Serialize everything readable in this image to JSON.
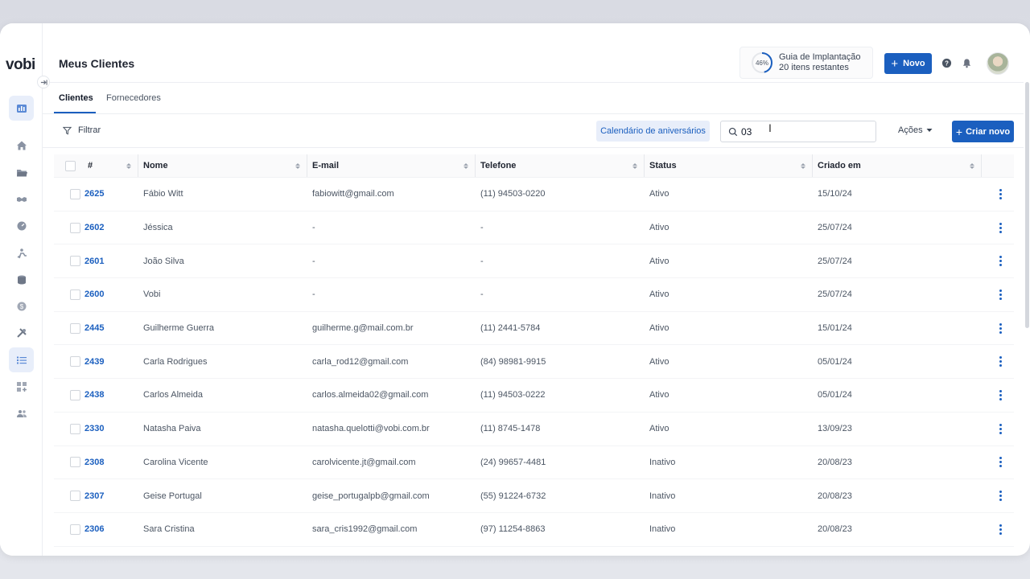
{
  "app": {
    "logo": "vobi"
  },
  "header": {
    "title": "Meus Clientes",
    "guide": {
      "percent": "46%",
      "progress": 0.46,
      "title": "Guia de Implantação",
      "subtitle": "20 itens restantes"
    },
    "new_button": "Novo"
  },
  "tabs": [
    {
      "label": "Clientes",
      "active": true
    },
    {
      "label": "Fornecedores",
      "active": false
    }
  ],
  "toolbar": {
    "filter_label": "Filtrar",
    "calendar_button": "Calendário de aniversários",
    "search_value": "03",
    "actions_label": "Ações",
    "create_button": "Criar novo"
  },
  "table": {
    "columns": [
      "#",
      "Nome",
      "E-mail",
      "Telefone",
      "Status",
      "Criado em"
    ],
    "rows": [
      {
        "id": "2625",
        "name": "Fábio Witt",
        "email": "fabiowitt@gmail.com",
        "phone": "(11) 94503-0220",
        "status": "Ativo",
        "created": "15/10/24"
      },
      {
        "id": "2602",
        "name": "Jéssica",
        "email": "-",
        "phone": "-",
        "status": "Ativo",
        "created": "25/07/24"
      },
      {
        "id": "2601",
        "name": "João Silva",
        "email": "-",
        "phone": "-",
        "status": "Ativo",
        "created": "25/07/24"
      },
      {
        "id": "2600",
        "name": "Vobi",
        "email": "-",
        "phone": "-",
        "status": "Ativo",
        "created": "25/07/24"
      },
      {
        "id": "2445",
        "name": "Guilherme Guerra",
        "email": "guilherme.g@mail.com.br",
        "phone": "(11) 2441-5784",
        "status": "Ativo",
        "created": "15/01/24"
      },
      {
        "id": "2439",
        "name": "Carla Rodrigues",
        "email": "carla_rod12@gmail.com",
        "phone": "(84) 98981-9915",
        "status": "Ativo",
        "created": "05/01/24"
      },
      {
        "id": "2438",
        "name": "Carlos Almeida",
        "email": "carlos.almeida02@gmail.com",
        "phone": "(11) 94503-0222",
        "status": "Ativo",
        "created": "05/01/24"
      },
      {
        "id": "2330",
        "name": "Natasha Paiva",
        "email": "natasha.quelotti@vobi.com.br",
        "phone": "(11) 8745-1478",
        "status": "Ativo",
        "created": "13/09/23"
      },
      {
        "id": "2308",
        "name": "Carolina Vicente",
        "email": "carolvicente.jt@gmail.com",
        "phone": "(24) 99657-4481",
        "status": "Inativo",
        "created": "20/08/23"
      },
      {
        "id": "2307",
        "name": "Geise Portugal",
        "email": "geise_portugalpb@gmail.com",
        "phone": "(55) 91224-6732",
        "status": "Inativo",
        "created": "20/08/23"
      },
      {
        "id": "2306",
        "name": "Sara Cristina",
        "email": "sara_cris1992@gmail.com",
        "phone": "(97) 11254-8863",
        "status": "Inativo",
        "created": "20/08/23"
      }
    ]
  },
  "sidebar": {
    "items": [
      {
        "icon": "dashboard-icon",
        "active": true
      },
      {
        "icon": "home-icon"
      },
      {
        "icon": "folder-icon"
      },
      {
        "icon": "handshake-icon"
      },
      {
        "icon": "gauge-icon"
      },
      {
        "icon": "worker-icon"
      },
      {
        "icon": "database-icon"
      },
      {
        "icon": "dollar-icon"
      },
      {
        "icon": "tools-icon"
      },
      {
        "icon": "list-icon",
        "active": true
      },
      {
        "icon": "apps-add-icon"
      },
      {
        "icon": "users-icon"
      }
    ]
  },
  "colors": {
    "primary": "#1b5fbf",
    "active_bg": "#e8eefa"
  }
}
